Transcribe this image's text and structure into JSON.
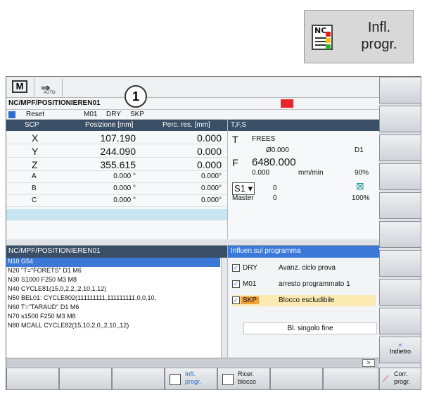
{
  "callout": {
    "icon": "nc-program-influence-icon",
    "nc_text": "NC",
    "label_line1": "Infl.",
    "label_line2": "progr."
  },
  "header": {
    "mode_icon1": "M",
    "mode_icon2_label": "AUTO",
    "program_path": "NC/MPF/POSITIONIEREN01",
    "callout_number": "1",
    "status": {
      "reset": "Reset",
      "m01": "M01",
      "dry": "DRY",
      "skp": "SKP"
    }
  },
  "axes": {
    "headers": {
      "scp": "SCP",
      "position": "Posizione [mm]",
      "remaining": "Perc. res. [mm]"
    },
    "rows": [
      {
        "name": "X",
        "pos": "107.190",
        "rem": "0.000"
      },
      {
        "name": "Y",
        "pos": "244.090",
        "rem": "0.000"
      },
      {
        "name": "Z",
        "pos": "355.615",
        "rem": "0.000"
      },
      {
        "name": "A",
        "pos": "0.000 °",
        "rem": "0.000°"
      },
      {
        "name": "B",
        "pos": "0.000 °",
        "rem": "0.000°"
      },
      {
        "name": "C",
        "pos": "0.000 °",
        "rem": "0.000°"
      }
    ]
  },
  "tfs": {
    "header": "T,F,S",
    "t_label": "T",
    "tool_name": "FREES",
    "tool_dia": "Ø0.000",
    "tool_d": "D1",
    "f_label": "F",
    "feed": "6480.000",
    "feed_actual": "0.000",
    "feed_unit": "mm/min",
    "feed_pct": "90%",
    "spindle": "S1",
    "spindle_val": "0",
    "master_label": "Master",
    "master_val": "0",
    "spindle_pct": "100%"
  },
  "program": {
    "header": "NC/MPF/POSITIONIEREN01",
    "lines": [
      "N10 G54",
      "N20 \"T=\"FORETS\" D1 M6",
      "N30 S1000 F250 M3 M8",
      "N40 CYCLE81(15,0,2,2,,2,10,1,12)",
      "N50 BEL01: CYCLE802(111111111,111111111,0,0,10,",
      "N60 T=\"TARAUD\" D1 M6",
      "N70 s1500 F250 M3 M8",
      "N80 MCALL CYCLE82(15,10,2,0,,2,10,,12)"
    ]
  },
  "influence": {
    "header": "Influen.sul programma",
    "options": [
      {
        "code": "DRY",
        "desc": "Avanz. ciclo prova",
        "checked": "✓"
      },
      {
        "code": "M01",
        "desc": "arresto programmato 1",
        "checked": "✓"
      },
      {
        "code": "SKP",
        "desc": "Blocco escludibile",
        "checked": "✓"
      }
    ],
    "single_block": "Bl. singolo fine"
  },
  "bottom": {
    "more": ">"
  },
  "softkeys_vertical": {
    "back_arrow": "«",
    "back": "Indietro"
  },
  "softkeys_horizontal": {
    "infl_line1": "Infl.",
    "infl_line2": "progr.",
    "search_line1": "Ricer.",
    "search_line2": "blocco",
    "corr_line1": "Corr.",
    "corr_line2": "progr."
  }
}
